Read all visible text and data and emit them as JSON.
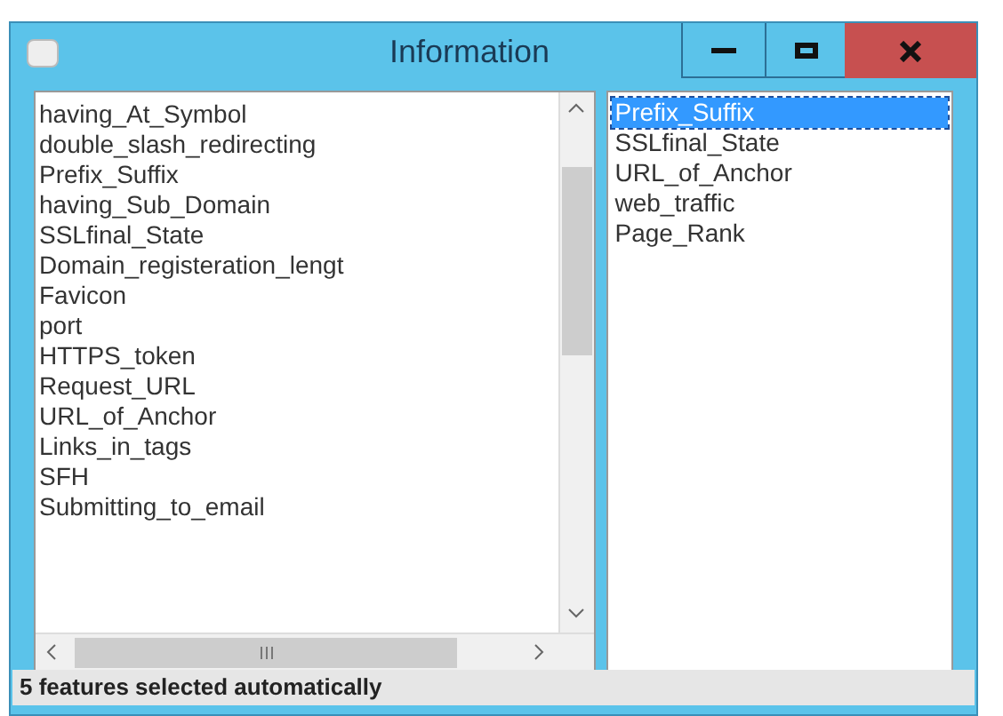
{
  "window": {
    "title": "Information"
  },
  "all_features": {
    "items": [
      {
        "label": "having_At_Symbol",
        "selected": false
      },
      {
        "label": "double_slash_redirecting",
        "selected": false
      },
      {
        "label": "Prefix_Suffix",
        "selected": false
      },
      {
        "label": "having_Sub_Domain",
        "selected": false
      },
      {
        "label": "SSLfinal_State",
        "selected": false
      },
      {
        "label": "Domain_registeration_lengt",
        "selected": false
      },
      {
        "label": "Favicon",
        "selected": false
      },
      {
        "label": "port",
        "selected": false
      },
      {
        "label": "HTTPS_token",
        "selected": false
      },
      {
        "label": "Request_URL",
        "selected": false
      },
      {
        "label": "URL_of_Anchor",
        "selected": false
      },
      {
        "label": "Links_in_tags",
        "selected": false
      },
      {
        "label": "SFH",
        "selected": false
      },
      {
        "label": "Submitting_to_email",
        "selected": false
      }
    ]
  },
  "selected_features": {
    "items": [
      {
        "label": "Prefix_Suffix",
        "selected": true
      },
      {
        "label": "SSLfinal_State",
        "selected": false
      },
      {
        "label": "URL_of_Anchor",
        "selected": false
      },
      {
        "label": "web_traffic",
        "selected": false
      },
      {
        "label": "Page_Rank",
        "selected": false
      }
    ]
  },
  "status_bar": "5 features selected automatically"
}
